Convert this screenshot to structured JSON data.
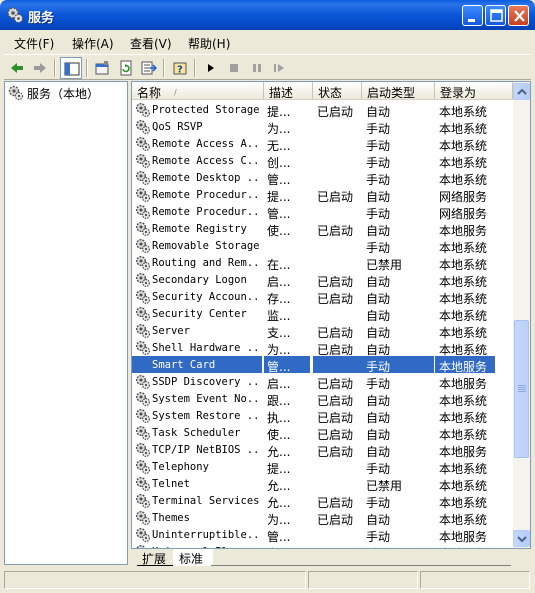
{
  "window": {
    "title": "服务"
  },
  "menu": [
    {
      "label": "文件(F)"
    },
    {
      "label": "操作(A)"
    },
    {
      "label": "查看(V)"
    },
    {
      "label": "帮助(H)"
    }
  ],
  "tree": {
    "root_label": "服务（本地）"
  },
  "columns": {
    "name": "名称",
    "desc": "描述",
    "status": "状态",
    "startup": "启动类型",
    "logon": "登录为"
  },
  "rows": [
    {
      "name": "Protected Storage",
      "desc": "提...",
      "status": "已启动",
      "startup": "自动",
      "logon": "本地系统"
    },
    {
      "name": "QoS RSVP",
      "desc": "为...",
      "status": "",
      "startup": "手动",
      "logon": "本地系统"
    },
    {
      "name": "Remote Access A...",
      "desc": "无...",
      "status": "",
      "startup": "手动",
      "logon": "本地系统"
    },
    {
      "name": "Remote Access C...",
      "desc": "创...",
      "status": "",
      "startup": "手动",
      "logon": "本地系统"
    },
    {
      "name": "Remote Desktop ...",
      "desc": "管...",
      "status": "",
      "startup": "手动",
      "logon": "本地系统"
    },
    {
      "name": "Remote Procedur...",
      "desc": "提...",
      "status": "已启动",
      "startup": "自动",
      "logon": "网络服务"
    },
    {
      "name": "Remote Procedur...",
      "desc": "管...",
      "status": "",
      "startup": "手动",
      "logon": "网络服务"
    },
    {
      "name": "Remote Registry",
      "desc": "使...",
      "status": "已启动",
      "startup": "自动",
      "logon": "本地服务"
    },
    {
      "name": "Removable Storage",
      "desc": "",
      "status": "",
      "startup": "手动",
      "logon": "本地系统"
    },
    {
      "name": "Routing and Rem...",
      "desc": "在...",
      "status": "",
      "startup": "已禁用",
      "logon": "本地系统"
    },
    {
      "name": "Secondary Logon",
      "desc": "启...",
      "status": "已启动",
      "startup": "自动",
      "logon": "本地系统"
    },
    {
      "name": "Security Accoun...",
      "desc": "存...",
      "status": "已启动",
      "startup": "自动",
      "logon": "本地系统"
    },
    {
      "name": "Security Center",
      "desc": "监...",
      "status": "",
      "startup": "自动",
      "logon": "本地系统"
    },
    {
      "name": "Server",
      "desc": "支...",
      "status": "已启动",
      "startup": "自动",
      "logon": "本地系统"
    },
    {
      "name": "Shell Hardware ...",
      "desc": "为...",
      "status": "已启动",
      "startup": "自动",
      "logon": "本地系统"
    },
    {
      "name": "Smart Card",
      "desc": "管...",
      "status": "",
      "startup": "手动",
      "logon": "本地服务",
      "selected": true
    },
    {
      "name": "SSDP Discovery ...",
      "desc": "启...",
      "status": "已启动",
      "startup": "手动",
      "logon": "本地服务"
    },
    {
      "name": "System Event No...",
      "desc": "跟...",
      "status": "已启动",
      "startup": "自动",
      "logon": "本地系统"
    },
    {
      "name": "System Restore ...",
      "desc": "执...",
      "status": "已启动",
      "startup": "自动",
      "logon": "本地系统"
    },
    {
      "name": "Task Scheduler",
      "desc": "使...",
      "status": "已启动",
      "startup": "自动",
      "logon": "本地系统"
    },
    {
      "name": "TCP/IP NetBIOS ...",
      "desc": "允...",
      "status": "已启动",
      "startup": "自动",
      "logon": "本地服务"
    },
    {
      "name": "Telephony",
      "desc": "提...",
      "status": "",
      "startup": "手动",
      "logon": "本地系统"
    },
    {
      "name": "Telnet",
      "desc": "允...",
      "status": "",
      "startup": "已禁用",
      "logon": "本地系统"
    },
    {
      "name": "Terminal Services",
      "desc": "允...",
      "status": "已启动",
      "startup": "手动",
      "logon": "本地系统"
    },
    {
      "name": "Themes",
      "desc": "为...",
      "status": "已启动",
      "startup": "自动",
      "logon": "本地系统"
    },
    {
      "name": "Uninterruptible...",
      "desc": "管...",
      "status": "",
      "startup": "手动",
      "logon": "本地服务"
    },
    {
      "name": "Universal Plug ...",
      "desc": "为...",
      "status": "",
      "startup": "手动",
      "logon": "本地服务"
    }
  ],
  "tabs": {
    "extended": "扩展",
    "standard": "标准"
  },
  "colors": {
    "title_blue": "#0a56d8",
    "selection": "#316ac5",
    "chrome": "#ece9d8"
  },
  "icons": [
    "services-icon",
    "back-arrow-icon",
    "forward-arrow-icon",
    "show-hide-tree-icon",
    "properties-icon",
    "refresh-icon",
    "export-list-icon",
    "help-icon",
    "start-service-icon",
    "stop-service-icon",
    "pause-service-icon",
    "restart-service-icon"
  ]
}
